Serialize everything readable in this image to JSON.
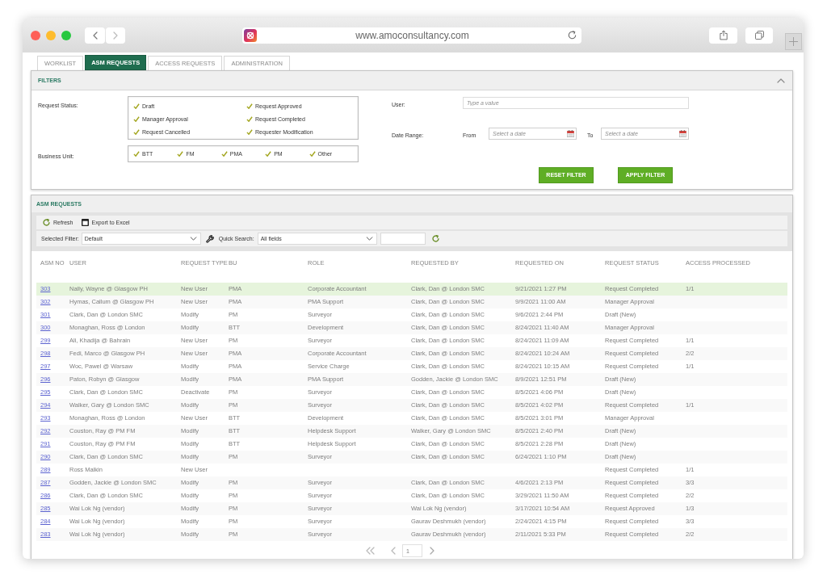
{
  "browser": {
    "url": "www.amoconsultancy.com"
  },
  "tabs": [
    {
      "label": "WORKLIST",
      "selected": false
    },
    {
      "label": "ASM REQUESTS",
      "selected": true
    },
    {
      "label": "ACCESS REQUESTS",
      "selected": false
    },
    {
      "label": "ADMINISTRATION",
      "selected": false
    }
  ],
  "filters": {
    "title": "FILTERS",
    "expanded": true,
    "request_status": {
      "label": "Request Status:",
      "options": [
        {
          "label": "Draft",
          "checked": true
        },
        {
          "label": "Request Approved",
          "checked": true
        },
        {
          "label": "Manager Approval",
          "checked": true
        },
        {
          "label": "Request Completed",
          "checked": true
        },
        {
          "label": "Request Cancelled",
          "checked": true
        },
        {
          "label": "Requester Modification",
          "checked": true
        }
      ]
    },
    "business_unit": {
      "label": "Business Unit:",
      "options": [
        {
          "label": "BTT",
          "checked": true
        },
        {
          "label": "FM",
          "checked": true
        },
        {
          "label": "PMA",
          "checked": true
        },
        {
          "label": "PM",
          "checked": true
        },
        {
          "label": "Other",
          "checked": true
        }
      ]
    },
    "user": {
      "label": "User:",
      "placeholder": "Type a value"
    },
    "date_range": {
      "label": "Date Range:",
      "from": {
        "label": "From",
        "placeholder": "Select a date"
      },
      "to": {
        "label": "To",
        "placeholder": "Select a date"
      }
    },
    "buttons": [
      {
        "label": "RESET FILTER"
      },
      {
        "label": "APPLY FILTER"
      }
    ]
  },
  "requests": {
    "title": "ASM REQUESTS",
    "actions": [
      {
        "kind": "refresh",
        "label": "Refresh"
      },
      {
        "kind": "export",
        "label": "Export to Excel"
      }
    ],
    "selected_filter": {
      "label": "Selected Filter:",
      "value": "Default"
    },
    "quick_search": {
      "label": "Quick Search:",
      "value": "All fields"
    },
    "table": {
      "columns": [
        "ASM NO",
        "USER",
        "REQUEST TYPE",
        "BU",
        "ROLE",
        "REQUESTED BY",
        "REQUESTED ON",
        "REQUEST STATUS",
        "ACCESS PROCESSED"
      ],
      "rows": [
        {
          "selected": true,
          "asm_no": "303",
          "user": "Nally, Wayne @ Glasgow PH",
          "request_type": "New User",
          "bu": "PMA",
          "role": "Corporate Accountant",
          "requested_by": "Clark, Dan @ London SMC",
          "requested_on": "9/21/2021 1:27 PM",
          "request_status": "Request Completed",
          "access_processed": "1/1"
        },
        {
          "selected": false,
          "asm_no": "302",
          "user": "Hymas, Callum @ Glasgow PH",
          "request_type": "New User",
          "bu": "PMA",
          "role": "PMA Support",
          "requested_by": "Clark, Dan @ London SMC",
          "requested_on": "9/9/2021 11:00 AM",
          "request_status": "Manager Approval"
        },
        {
          "selected": false,
          "asm_no": "301",
          "user": "Clark, Dan @ London SMC",
          "request_type": "Modify",
          "bu": "PM",
          "role": "Surveyor",
          "requested_by": "Clark, Dan @ London SMC",
          "requested_on": "9/6/2021 2:44 PM",
          "request_status": "Draft (New)"
        },
        {
          "selected": false,
          "asm_no": "300",
          "user": "Monaghan, Ross @ London",
          "request_type": "Modify",
          "bu": "BTT",
          "role": "Development",
          "requested_by": "Clark, Dan @ London SMC",
          "requested_on": "8/24/2021 11:40 AM",
          "request_status": "Manager Approval"
        },
        {
          "selected": false,
          "asm_no": "299",
          "user": "Ali, Khadija @ Bahrain",
          "request_type": "New User",
          "bu": "PM",
          "role": "Surveyor",
          "requested_by": "Clark, Dan @ London SMC",
          "requested_on": "8/24/2021 11:09 AM",
          "request_status": "Request Completed",
          "access_processed": "1/1"
        },
        {
          "selected": false,
          "asm_no": "298",
          "user": "Fedi, Marco @ Glasgow PH",
          "request_type": "New User",
          "bu": "PMA",
          "role": "Corporate Accountant",
          "requested_by": "Clark, Dan @ London SMC",
          "requested_on": "8/24/2021 10:24 AM",
          "request_status": "Request Completed",
          "access_processed": "2/2"
        },
        {
          "selected": false,
          "asm_no": "297",
          "user": "Woc, Pawel @ Warsaw",
          "request_type": "Modify",
          "bu": "PMA",
          "role": "Service Charge",
          "requested_by": "Clark, Dan @ London SMC",
          "requested_on": "8/24/2021 10:15 AM",
          "request_status": "Request Completed",
          "access_processed": "1/1"
        },
        {
          "selected": false,
          "asm_no": "296",
          "user": "Paton, Robyn @ Glasgow",
          "request_type": "Modify",
          "bu": "PMA",
          "role": "PMA Support",
          "requested_by": "Godden, Jackie @ London SMC",
          "requested_on": "8/9/2021 12:51 PM",
          "request_status": "Draft (New)"
        },
        {
          "selected": false,
          "asm_no": "295",
          "user": "Clark, Dan @ London SMC",
          "request_type": "Deactivate",
          "bu": "PM",
          "role": "Surveyor",
          "requested_by": "Clark, Dan @ London SMC",
          "requested_on": "8/5/2021 4:06 PM",
          "request_status": "Draft (New)"
        },
        {
          "selected": false,
          "asm_no": "294",
          "user": "Walker, Gary @ London SMC",
          "request_type": "Modify",
          "bu": "PM",
          "role": "Surveyor",
          "requested_by": "Clark, Dan @ London SMC",
          "requested_on": "8/5/2021 4:02 PM",
          "request_status": "Request Completed",
          "access_processed": "1/1"
        },
        {
          "selected": false,
          "asm_no": "293",
          "user": "Monaghan, Ross @ London",
          "request_type": "New User",
          "bu": "BTT",
          "role": "Development",
          "requested_by": "Clark, Dan @ London SMC",
          "requested_on": "8/5/2021 3:01 PM",
          "request_status": "Manager Approval"
        },
        {
          "selected": false,
          "asm_no": "292",
          "user": "Couston, Ray @ PM FM",
          "request_type": "Modify",
          "bu": "BTT",
          "role": "Helpdesk Support",
          "requested_by": "Walker, Gary @ London SMC",
          "requested_on": "8/5/2021 2:40 PM",
          "request_status": "Draft (New)"
        },
        {
          "selected": false,
          "asm_no": "291",
          "user": "Couston, Ray @ PM FM",
          "request_type": "Modify",
          "bu": "BTT",
          "role": "Helpdesk Support",
          "requested_by": "Clark, Dan @ London SMC",
          "requested_on": "8/5/2021 2:28 PM",
          "request_status": "Draft (New)"
        },
        {
          "selected": false,
          "asm_no": "290",
          "user": "Clark, Dan @ London SMC",
          "request_type": "Modify",
          "bu": "PM",
          "role": "Surveyor",
          "requested_by": "Clark, Dan @ London SMC",
          "requested_on": "6/24/2021 1:10 PM",
          "request_status": "Draft (New)"
        },
        {
          "selected": false,
          "asm_no": "289",
          "user": "Ross Malkin",
          "request_type": "New User",
          "request_status": "Request Completed",
          "access_processed": "1/1"
        },
        {
          "selected": false,
          "asm_no": "287",
          "user": "Godden, Jackie @ London SMC",
          "request_type": "Modify",
          "bu": "PM",
          "role": "Surveyor",
          "requested_by": "Clark, Dan @ London SMC",
          "requested_on": "4/6/2021 2:13 PM",
          "request_status": "Request Completed",
          "access_processed": "3/3"
        },
        {
          "selected": false,
          "asm_no": "286",
          "user": "Clark, Dan @ London SMC",
          "request_type": "Modify",
          "bu": "PM",
          "role": "Surveyor",
          "requested_by": "Clark, Dan @ London SMC",
          "requested_on": "3/29/2021 11:50 AM",
          "request_status": "Request Completed",
          "access_processed": "2/2"
        },
        {
          "selected": false,
          "asm_no": "285",
          "user": "Wai Lok Ng (vendor)",
          "request_type": "Modify",
          "bu": "PM",
          "role": "Surveyor",
          "requested_by": "Wai Lok Ng (vendor)",
          "requested_on": "3/17/2021 10:54 AM",
          "request_status": "Request Approved",
          "access_processed": "1/3"
        },
        {
          "selected": false,
          "asm_no": "284",
          "user": "Wai Lok Ng (vendor)",
          "request_type": "Modify",
          "bu": "PM",
          "role": "Surveyor",
          "requested_by": "Gaurav Deshmukh (vendor)",
          "requested_on": "2/24/2021 4:15 PM",
          "request_status": "Request Completed",
          "access_processed": "3/3"
        },
        {
          "selected": false,
          "asm_no": "283",
          "user": "Wai Lok Ng (vendor)",
          "request_type": "Modify",
          "bu": "PM",
          "role": "Surveyor",
          "requested_by": "Gaurav Deshmukh (vendor)",
          "requested_on": "2/11/2021 5:33 PM",
          "request_status": "Request Completed",
          "access_processed": "2/2"
        }
      ]
    },
    "pagination": {
      "page": "1"
    }
  }
}
